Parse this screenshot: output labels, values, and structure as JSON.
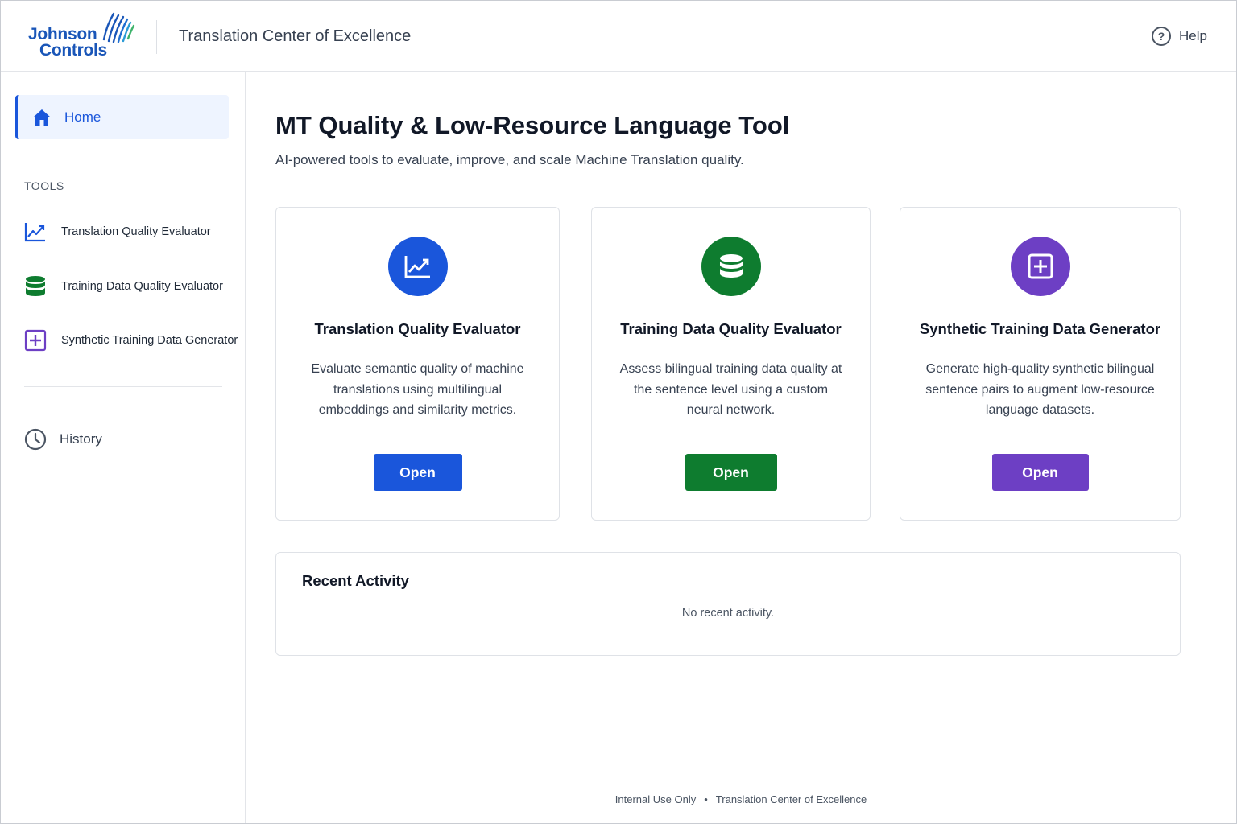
{
  "header": {
    "logo_line1": "Johnson",
    "logo_line2": "Controls",
    "app_title": "Translation Center of Excellence",
    "help_label": "Help"
  },
  "sidebar": {
    "home_label": "Home",
    "tools_section_label": "TOOLS",
    "tools": [
      {
        "label": "Translation Quality Evaluator",
        "icon": "chart-line-icon"
      },
      {
        "label": "Training Data Quality Evaluator",
        "icon": "database-icon"
      },
      {
        "label": "Synthetic Training Data Generator",
        "icon": "plus-square-icon"
      }
    ],
    "history_label": "History"
  },
  "main": {
    "title": "MT Quality & Low-Resource Language Tool",
    "subtitle": "AI-powered tools to evaluate, improve, and scale Machine Translation quality.",
    "cards": [
      {
        "title": "Translation Quality Evaluator",
        "description": "Evaluate semantic quality of machine translations using multilingual embeddings and similarity metrics.",
        "button_label": "Open",
        "color": "#1a56db",
        "icon": "chart-line-icon"
      },
      {
        "title": "Training Data Quality Evaluator",
        "description": "Assess bilingual training data quality at the sentence level using a custom neural network.",
        "button_label": "Open",
        "color": "#0e7c2f",
        "icon": "database-icon"
      },
      {
        "title": "Synthetic Training Data Generator",
        "description": "Generate high-quality synthetic bilingual sentence pairs to augment low-resource language datasets.",
        "button_label": "Open",
        "color": "#6d3fc4",
        "icon": "plus-square-icon"
      }
    ],
    "recent_activity": {
      "title": "Recent Activity",
      "empty_text": "No recent activity."
    }
  },
  "footer": {
    "left": "Internal Use Only",
    "separator": "•",
    "right": "Translation Center of Excellence"
  },
  "colors": {
    "brand_blue": "#1a56b8",
    "accent_blue": "#1a56db",
    "accent_green": "#0e7c2f",
    "accent_purple": "#6d3fc4"
  }
}
